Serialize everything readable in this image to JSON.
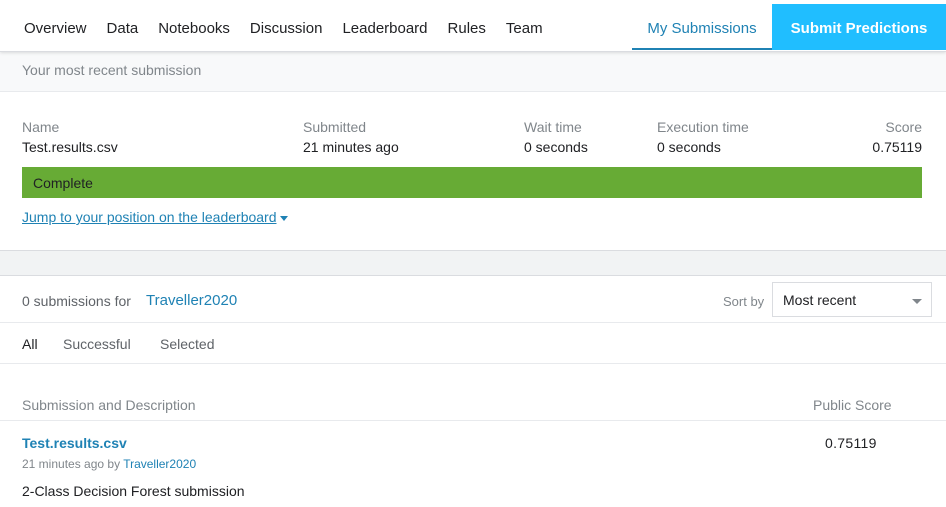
{
  "nav": {
    "tabs": [
      "Overview",
      "Data",
      "Notebooks",
      "Discussion",
      "Leaderboard",
      "Rules",
      "Team"
    ],
    "my_submissions": "My Submissions",
    "submit_predictions": "Submit Predictions"
  },
  "recent": {
    "header": "Your most recent submission",
    "columns": {
      "name": "Name",
      "submitted": "Submitted",
      "wait": "Wait time",
      "exec": "Execution time",
      "score": "Score"
    },
    "values": {
      "name": "Test.results.csv",
      "submitted": "21 minutes ago",
      "wait": "0 seconds",
      "exec": "0 seconds",
      "score": "0.75119"
    },
    "status": "Complete",
    "status_color": "#67ab35",
    "jump_link": "Jump to your position on the leaderboard"
  },
  "submissions": {
    "count_text": "0 submissions for",
    "user": "Traveller2020",
    "sort_label": "Sort by",
    "sort_value": "Most recent",
    "filters": [
      "All",
      "Successful",
      "Selected"
    ],
    "active_filter": "All",
    "columns": {
      "left": "Submission and Description",
      "right": "Public Score"
    },
    "rows": [
      {
        "file": "Test.results.csv",
        "time": "21 minutes ago by",
        "user": "Traveller2020",
        "description": "2-Class Decision Forest submission",
        "score": "0.75119"
      }
    ]
  },
  "colors": {
    "accent": "#1f82b4",
    "submit_bg": "#20beff"
  }
}
